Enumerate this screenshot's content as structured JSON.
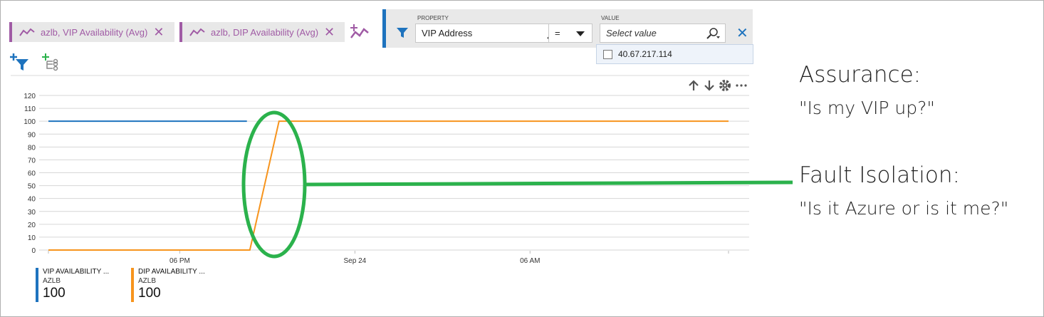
{
  "metrics": [
    {
      "label": "azlb, VIP Availability (Avg)",
      "icon": "line-chart-icon"
    },
    {
      "label": "azlb, DIP Availability (Avg)",
      "icon": "line-chart-icon"
    }
  ],
  "filter": {
    "property_label": "PROPERTY",
    "property_value": "VIP Address",
    "operator": "=",
    "value_label": "VALUE",
    "value_placeholder": "Select value",
    "options": [
      "40.67.217.114"
    ]
  },
  "annotations": {
    "assurance_title": "Assurance:",
    "assurance_question": "\"Is my VIP up?\"",
    "fault_title": "Fault Isolation:",
    "fault_question": "\"Is it Azure or is it me?\""
  },
  "legend": [
    {
      "title": "VIP AVAILABILITY ...",
      "sub": "AZLB",
      "value": "100",
      "color": "#1e73be"
    },
    {
      "title": "DIP AVAILABILITY ...",
      "sub": "AZLB",
      "value": "100",
      "color": "#f7941d"
    }
  ],
  "colors": {
    "accent": "#a05ba5",
    "filter": "#1e73be",
    "highlight": "#2bb24c"
  },
  "chart_data": {
    "type": "line",
    "ylim": [
      0,
      120
    ],
    "yticks": [
      0,
      10,
      20,
      30,
      40,
      50,
      60,
      70,
      80,
      90,
      100,
      110,
      120
    ],
    "xtick_labels": [
      "06 PM",
      "Sep 24",
      "06 AM"
    ],
    "xlim_hours": [
      -4.5,
      18.8
    ],
    "xtick_hours": [
      0,
      6,
      12
    ],
    "grid": true,
    "series": [
      {
        "name": "VIP AVAILABILITY ...",
        "color": "#1e73be",
        "x_hours": [
          -4.5,
          2.3
        ],
        "values": [
          100,
          100
        ]
      },
      {
        "name": "DIP AVAILABILITY ...",
        "color": "#f7941d",
        "x_hours": [
          -4.5,
          2.4,
          3.4,
          18.8
        ],
        "values": [
          0,
          0,
          100,
          100
        ]
      }
    ]
  }
}
